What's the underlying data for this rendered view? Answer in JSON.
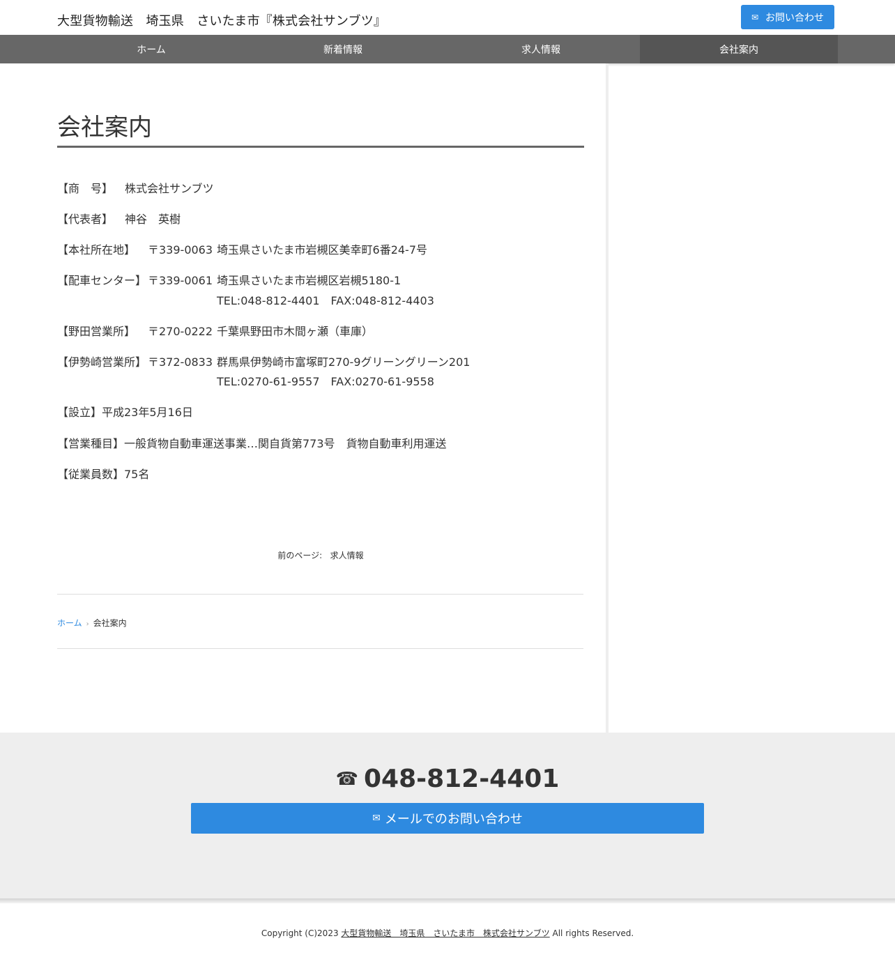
{
  "header": {
    "site_title": "大型貨物輸送　埼玉県　さいたま市『株式会社サンブツ』",
    "contact_button": {
      "icon": "envelope-icon",
      "icon_glyph": "✉",
      "label": "お問い合わせ"
    }
  },
  "nav": {
    "items": [
      {
        "label": "ホーム",
        "active": false
      },
      {
        "label": "新着情報",
        "active": false
      },
      {
        "label": "求人情報",
        "active": false
      },
      {
        "label": "会社案内",
        "active": true
      }
    ]
  },
  "main": {
    "title": "会社案内",
    "info": {
      "trade_name": {
        "label": "【商　号】",
        "value": "株式会社サンブツ"
      },
      "representative": {
        "label": "【代表者】",
        "value": "神谷　英樹"
      },
      "head_office": {
        "label": "【本社所在地】",
        "postal": "〒339-0063",
        "address": "埼玉県さいたま市岩槻区美幸町6番24-7号"
      },
      "dispatch_center": {
        "label": "【配車センター】",
        "postal": "〒339-0061",
        "address": "埼玉県さいたま市岩槻区岩槻5180-1",
        "tel_fax": "TEL:048-812-4401　FAX:048-812-4403"
      },
      "noda_office": {
        "label": "【野田営業所】",
        "postal": "〒270-0222",
        "address": "千葉県野田市木間ヶ瀬（車庫）"
      },
      "isesaki_office": {
        "label": "【伊勢崎営業所】",
        "postal": "〒372-0833",
        "address": "群馬県伊勢崎市富塚町270-9グリーングリーン201",
        "tel_fax": "TEL:0270-61-9557　FAX:0270-61-9558"
      },
      "established": "【設立】平成23年5月16日",
      "business_type": "【営業種目】一般貨物自動車運送事業…関自貨第773号　貨物自動車利用運送",
      "employees": "【従業員数】75名"
    },
    "prev_page": {
      "prefix": "前のページ:",
      "link": "求人情報"
    },
    "breadcrumb": {
      "home": "ホーム",
      "separator": "›",
      "current": "会社案内"
    }
  },
  "footer": {
    "phone_icon": "phone-icon",
    "phone_glyph": "☎",
    "phone": "048-812-4401",
    "mail_button": {
      "icon": "envelope-icon",
      "icon_glyph": "✉",
      "label": "メールでのお問い合わせ"
    },
    "copyright": {
      "prefix": "Copyright (C)2023 ",
      "link": "大型貨物輸送　埼玉県　さいたま市　株式会社サンブツ",
      "suffix": " All rights Reserved."
    }
  },
  "colors": {
    "accent": "#2e8ae0",
    "nav_bg": "#676767",
    "nav_active": "#555555",
    "footer_bg": "#eeeeee"
  }
}
